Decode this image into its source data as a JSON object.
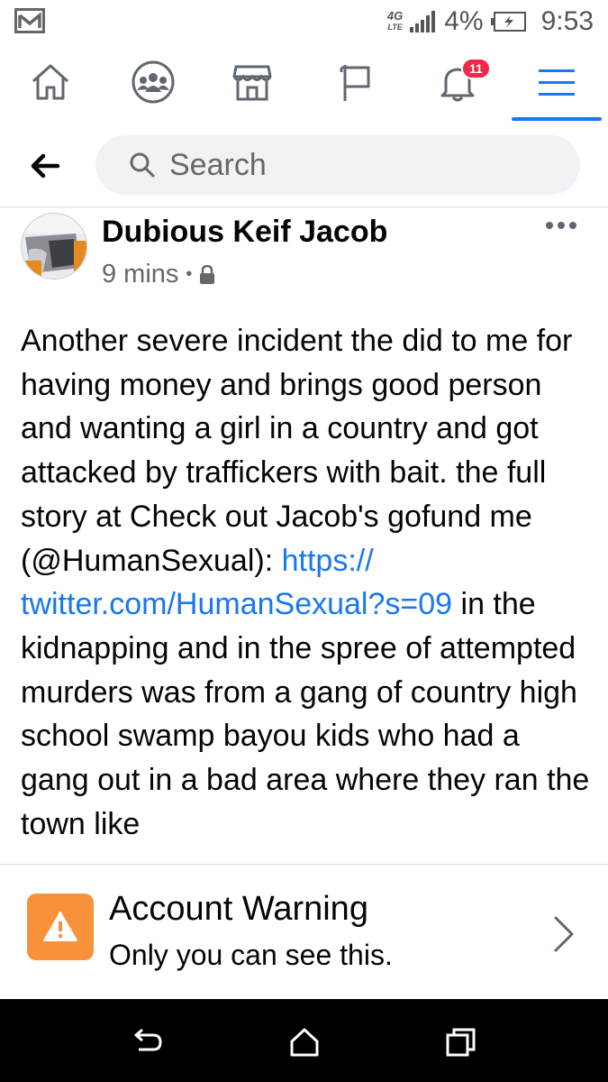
{
  "status_bar": {
    "network": "4G",
    "network_sub": "LTE",
    "battery_pct": "4%",
    "time": "9:53",
    "icons": [
      "gmail-icon",
      "signal-icon",
      "battery-icon"
    ]
  },
  "nav": {
    "items": [
      {
        "name": "home",
        "icon": "home-icon"
      },
      {
        "name": "groups",
        "icon": "groups-icon"
      },
      {
        "name": "marketplace",
        "icon": "marketplace-icon"
      },
      {
        "name": "pages",
        "icon": "flag-icon"
      },
      {
        "name": "notifications",
        "icon": "bell-icon",
        "badge": "11"
      },
      {
        "name": "menu",
        "icon": "menu-icon",
        "active": true
      }
    ],
    "active_color": "#1877f2"
  },
  "search": {
    "placeholder": "Search"
  },
  "post": {
    "author": "Dubious Keif Jacob",
    "time": "9 mins",
    "separator": "•",
    "privacy_icon": "lock-icon",
    "body_before_link": "Another severe incident the did to me for having money and brings good person and wanting a girl in a country and got attacked by traffickers with bait.  the full story at Check out Jacob's gofund me (@HumanSexual): ",
    "link_text": "https:// twitter.com/HumanSexual?s=09",
    "body_after_link": " in the kidnapping and in the spree of attempted murders was from a gang of country high school swamp bayou kids who had a gang out in a bad area where they ran the town like",
    "link_color": "#1877f2"
  },
  "warning": {
    "title": "Account Warning",
    "subtitle": "Only you can see this.",
    "icon": "warning-icon",
    "icon_color": "#f7923b"
  },
  "android_nav": {
    "buttons": [
      "back-icon",
      "home-icon",
      "recents-icon"
    ]
  }
}
